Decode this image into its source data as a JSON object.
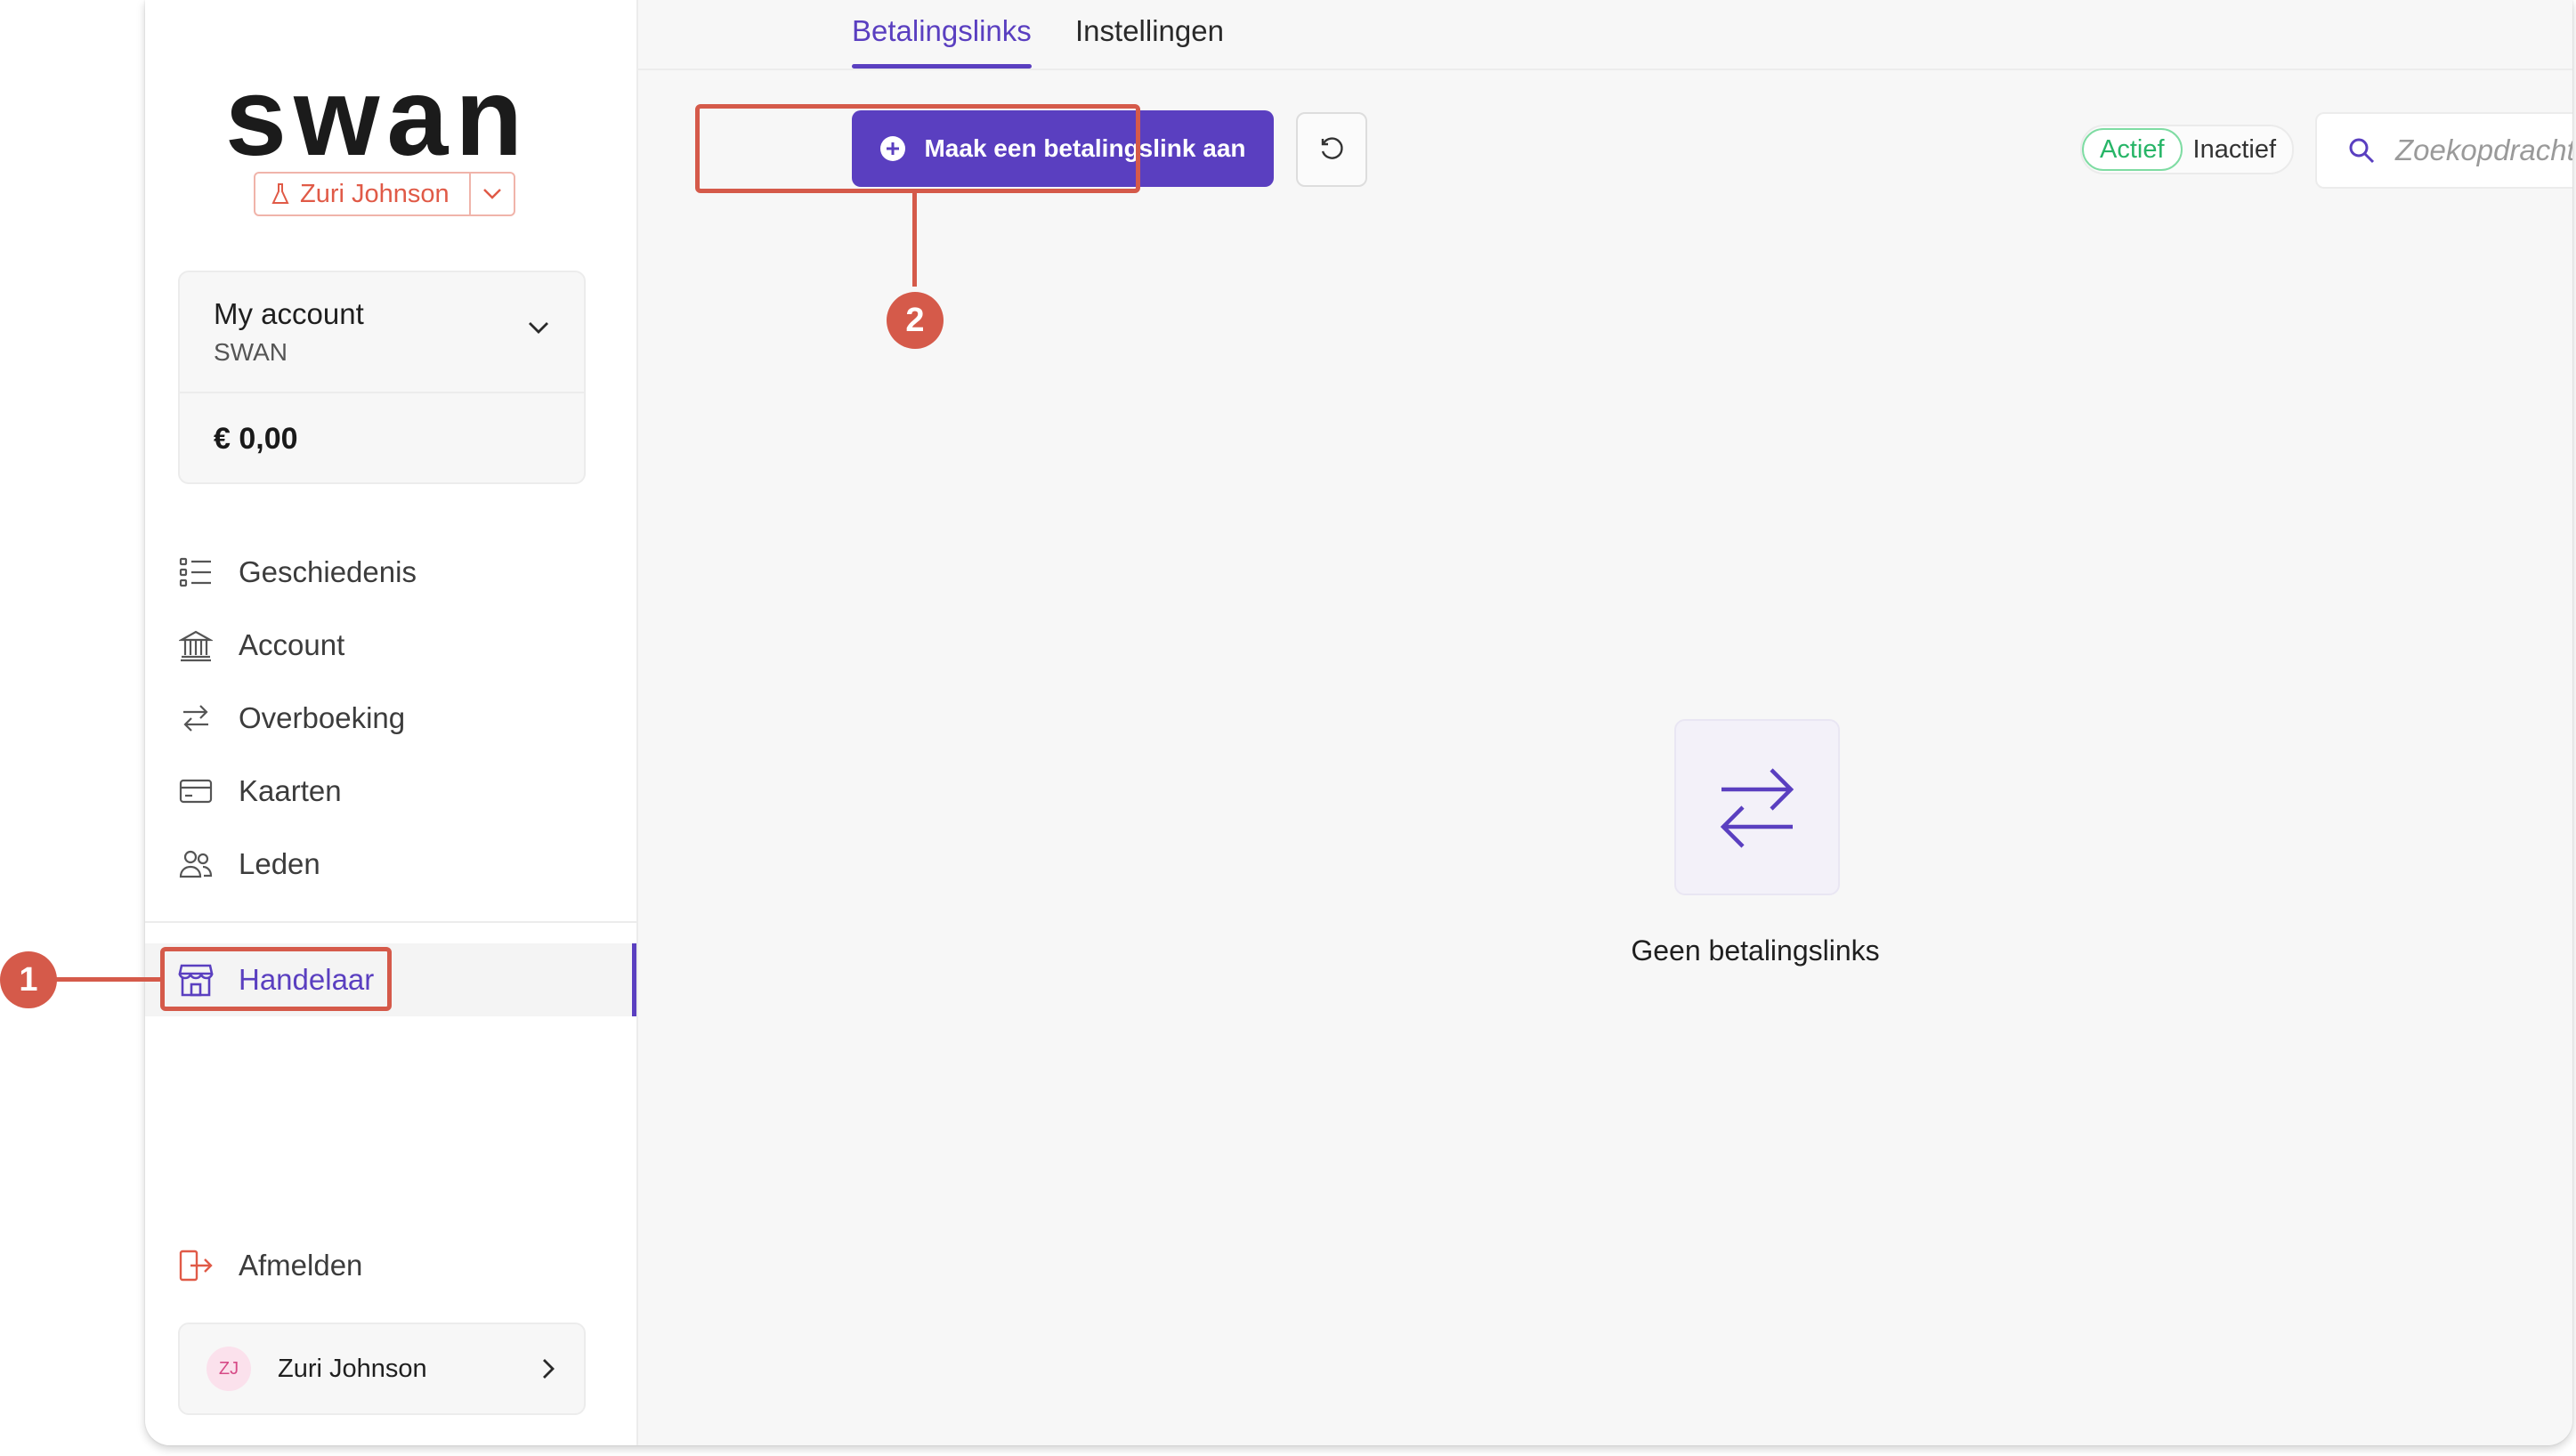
{
  "brand": {
    "logo_text": "swan",
    "accent": "#5a3fc0",
    "annotation_color": "#d55a4a"
  },
  "sidebar": {
    "user_chip": {
      "name": "Zuri Johnson",
      "icon": "flask-icon"
    },
    "account": {
      "name": "My account",
      "org": "SWAN",
      "balance": "€ 0,00"
    },
    "nav": [
      {
        "label": "Geschiedenis",
        "icon": "list-icon"
      },
      {
        "label": "Account",
        "icon": "bank-icon"
      },
      {
        "label": "Overboeking",
        "icon": "transfer-icon"
      },
      {
        "label": "Kaarten",
        "icon": "card-icon"
      },
      {
        "label": "Leden",
        "icon": "members-icon"
      },
      {
        "label": "Handelaar",
        "icon": "store-icon",
        "active": true
      }
    ],
    "logout_label": "Afmelden",
    "user": {
      "initials": "ZJ",
      "name": "Zuri Johnson"
    }
  },
  "main": {
    "tabs": [
      {
        "label": "Betalingslinks",
        "active": true
      },
      {
        "label": "Instellingen",
        "active": false
      }
    ],
    "create_button": "Maak een betalingslink aan",
    "filter": {
      "active_label": "Actief",
      "inactive_label": "Inactief",
      "selected": "Actief"
    },
    "search_placeholder": "Zoekopdracht",
    "empty_text": "Geen betalingslinks"
  },
  "annotations": {
    "marker_1": "1",
    "marker_2": "2"
  }
}
